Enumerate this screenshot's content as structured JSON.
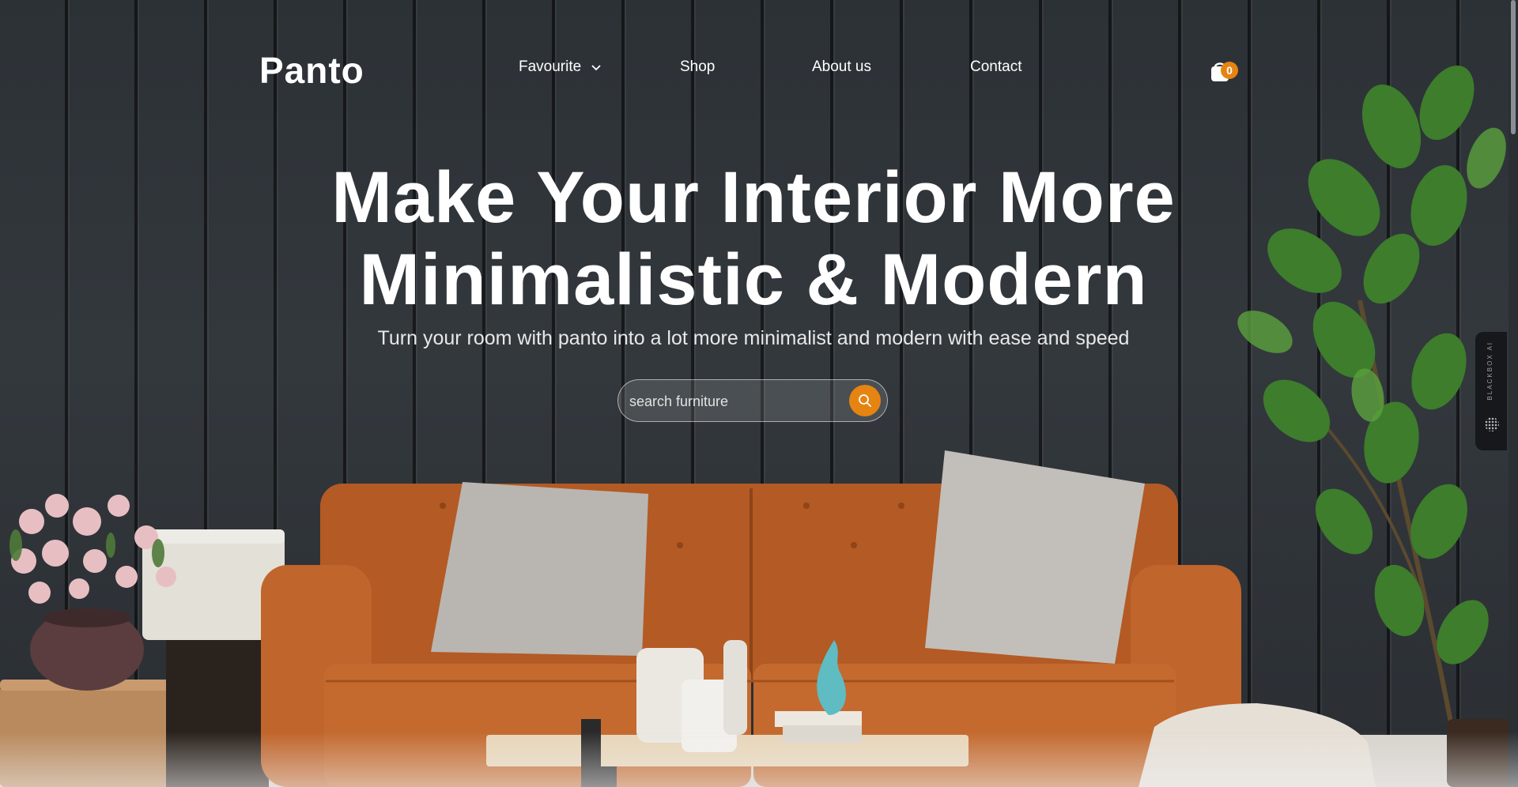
{
  "brand": {
    "logo": "Panto"
  },
  "nav": {
    "items": [
      {
        "label": "Favourite",
        "has_dropdown": true
      },
      {
        "label": "Shop"
      },
      {
        "label": "About us"
      },
      {
        "label": "Contact"
      }
    ],
    "cart": {
      "count": "0",
      "icon": "shopping-bag-icon"
    }
  },
  "hero": {
    "title_line1": "Make Your Interior More",
    "title_line2": "Minimalistic & Modern",
    "subtitle": "Turn your room with panto into a lot more minimalist and modern with ease and speed"
  },
  "search": {
    "placeholder": "search furniture",
    "icon": "search-icon"
  },
  "side_widget": {
    "label": "BLACKBOX AI"
  },
  "colors": {
    "accent": "#E58411",
    "wall": "#2F3439",
    "sofa": "#B85A22",
    "text": "#FFFFFF"
  }
}
